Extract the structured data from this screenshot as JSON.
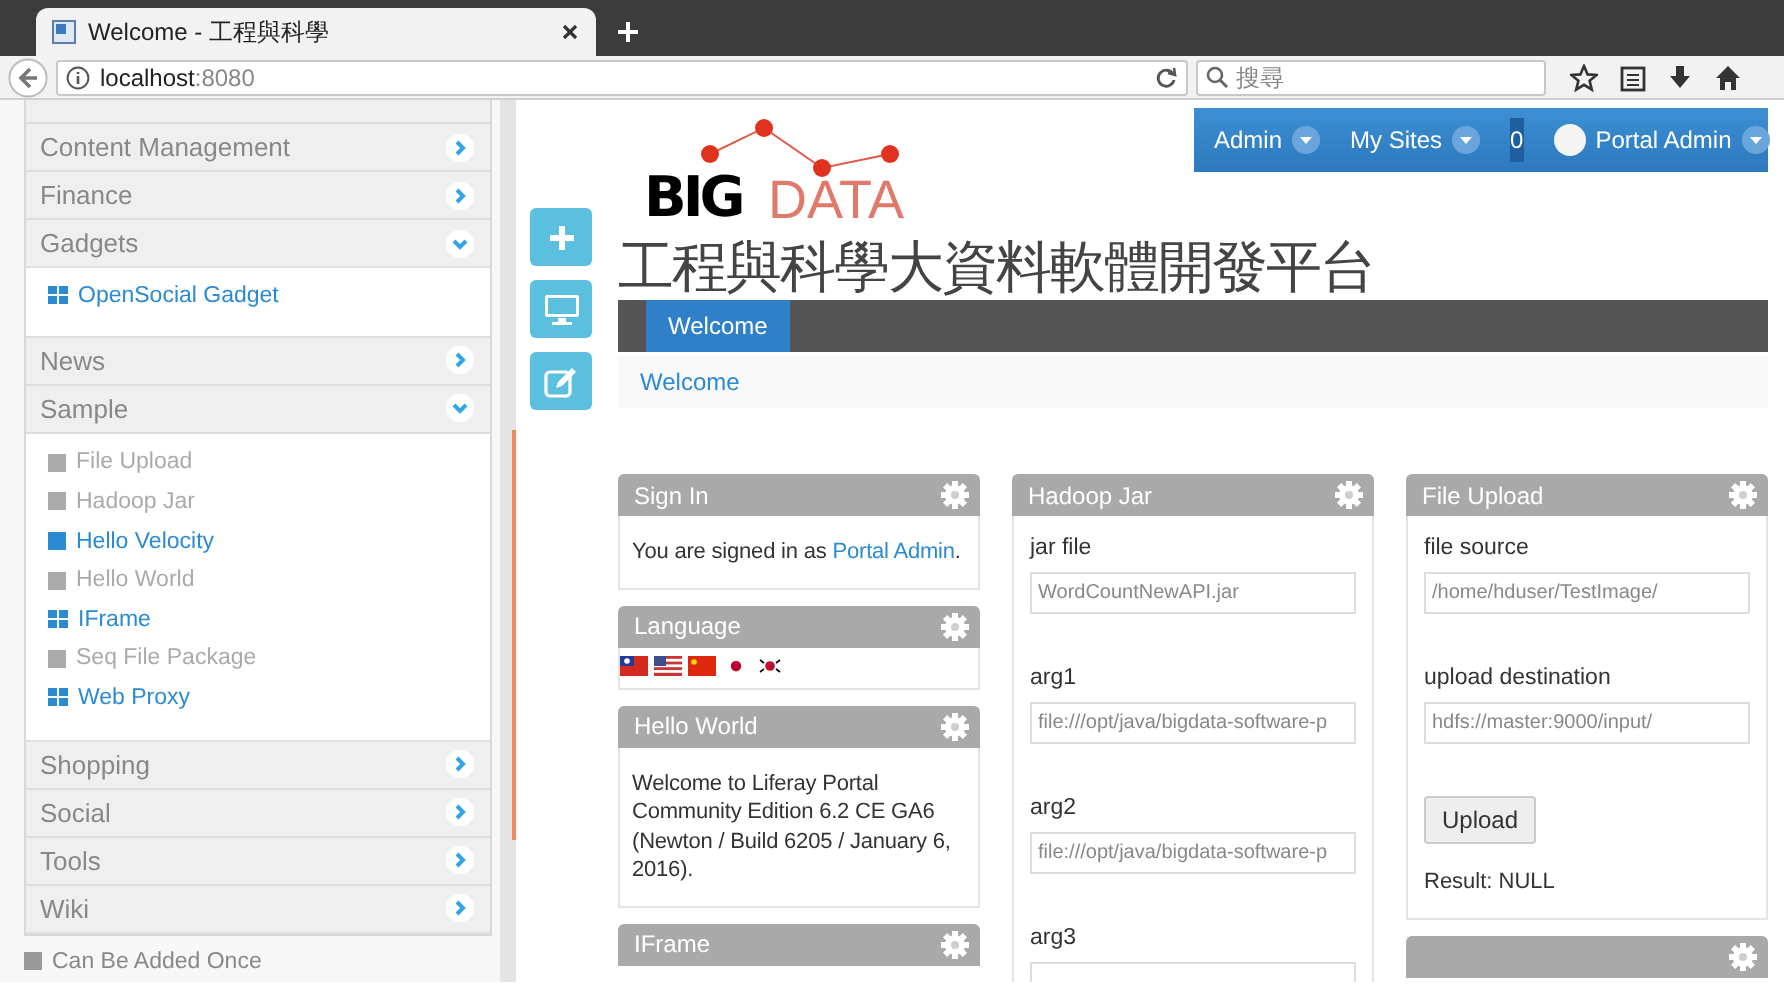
{
  "browser": {
    "tab_title": "Welcome - 工程與科學",
    "url_host": "localhost",
    "url_port": ":8080",
    "search_placeholder": "搜尋"
  },
  "sidebar": {
    "categories": [
      {
        "label": "Content Management",
        "expanded": false
      },
      {
        "label": "Finance",
        "expanded": false
      },
      {
        "label": "Gadgets",
        "expanded": true,
        "items": [
          {
            "label": "OpenSocial Gadget",
            "kind": "multi",
            "disabled": false
          }
        ]
      },
      {
        "label": "News",
        "expanded": false
      },
      {
        "label": "Sample",
        "expanded": true,
        "items": [
          {
            "label": "File Upload",
            "kind": "single",
            "disabled": true
          },
          {
            "label": "Hadoop Jar",
            "kind": "single",
            "disabled": true
          },
          {
            "label": "Hello Velocity",
            "kind": "single",
            "disabled": false
          },
          {
            "label": "Hello World",
            "kind": "single",
            "disabled": true
          },
          {
            "label": "IFrame",
            "kind": "multi",
            "disabled": false
          },
          {
            "label": "Seq File Package",
            "kind": "single",
            "disabled": true
          },
          {
            "label": "Web Proxy",
            "kind": "multi",
            "disabled": false
          }
        ]
      },
      {
        "label": "Shopping",
        "expanded": false
      },
      {
        "label": "Social",
        "expanded": false
      },
      {
        "label": "Tools",
        "expanded": false
      },
      {
        "label": "Wiki",
        "expanded": false
      }
    ],
    "legend": "Can Be Added Once"
  },
  "dock": {
    "menus": [
      {
        "label": "Admin"
      },
      {
        "label": "My Sites"
      }
    ],
    "notifications": "0",
    "user": "Portal Admin"
  },
  "site": {
    "logo": {
      "big": "BIG",
      "data": "DATA"
    },
    "title": "工程與科學大資料軟體開發平台",
    "nav": [
      {
        "label": "Welcome",
        "selected": true
      }
    ],
    "breadcrumb": "Welcome"
  },
  "columns": [
    [
      {
        "title": "Sign In",
        "kind": "signin",
        "text": "You are signed in as ",
        "link": "Portal Admin",
        "text_end": "."
      },
      {
        "title": "Language",
        "kind": "flags"
      },
      {
        "title": "Hello World",
        "kind": "text",
        "text": "Welcome to Liferay Portal Community Edition 6.2 CE GA6 (Newton / Build 6205 / January 6, 2016)."
      },
      {
        "title": "IFrame",
        "kind": "empty"
      }
    ],
    [
      {
        "title": "Hadoop Jar",
        "kind": "form",
        "fields": [
          {
            "label": "jar file",
            "placeholder": "WordCountNewAPI.jar"
          },
          {
            "label": "arg1",
            "placeholder": "file:///opt/java/bigdata-software-p"
          },
          {
            "label": "arg2",
            "placeholder": "file:///opt/java/bigdata-software-p"
          },
          {
            "label": "arg3"
          }
        ]
      }
    ],
    [
      {
        "title": "File Upload",
        "kind": "form",
        "fields": [
          {
            "label": "file source",
            "placeholder": "/home/hduser/TestImage/"
          },
          {
            "label": "upload destination",
            "placeholder": "hdfs://master:9000/input/"
          }
        ],
        "button": "Upload",
        "result": "Result: NULL"
      },
      {
        "kind": "empty"
      }
    ]
  ]
}
